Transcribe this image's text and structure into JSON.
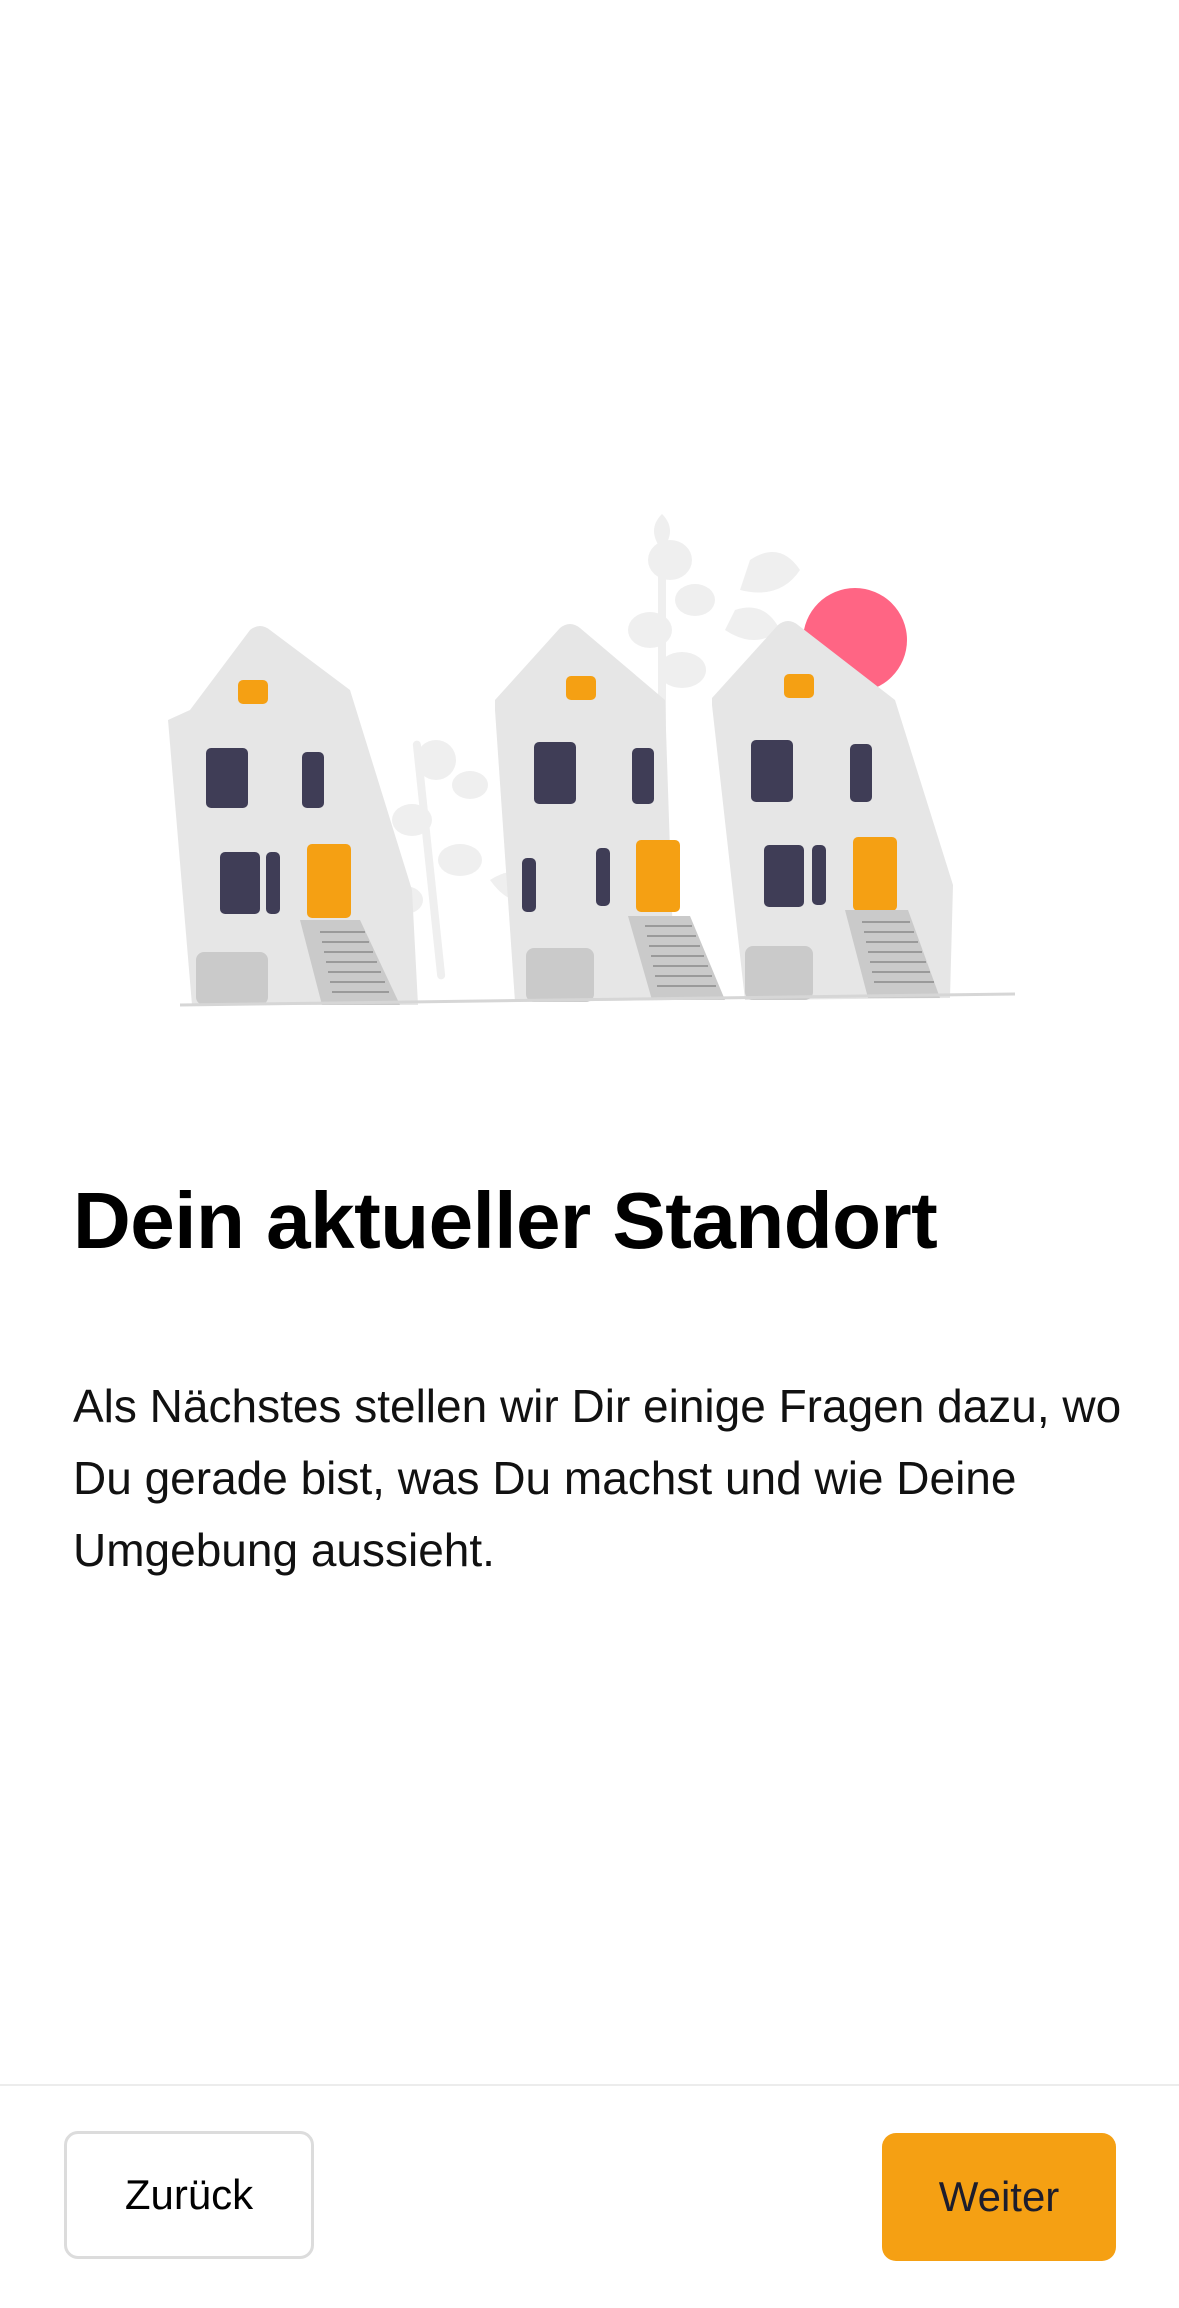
{
  "screen": {
    "title": "Dein aktueller Standort",
    "body": "Als Nächstes stellen wir Dir einige Fragen dazu, wo Du gerade bist, was Du machst und wie Deine Umgebung aussieht."
  },
  "illustration": {
    "icon": "houses-illustration",
    "colors": {
      "house": "#e6e6e6",
      "window": "#3f3d56",
      "accent": "#f5a013",
      "sun": "#ff6584",
      "plant": "#efefef",
      "door_base": "#cacaca"
    }
  },
  "footer": {
    "back_label": "Zurück",
    "next_label": "Weiter"
  },
  "colors": {
    "accent": "#f5a013",
    "background": "#ffffff",
    "text": "#000000"
  }
}
